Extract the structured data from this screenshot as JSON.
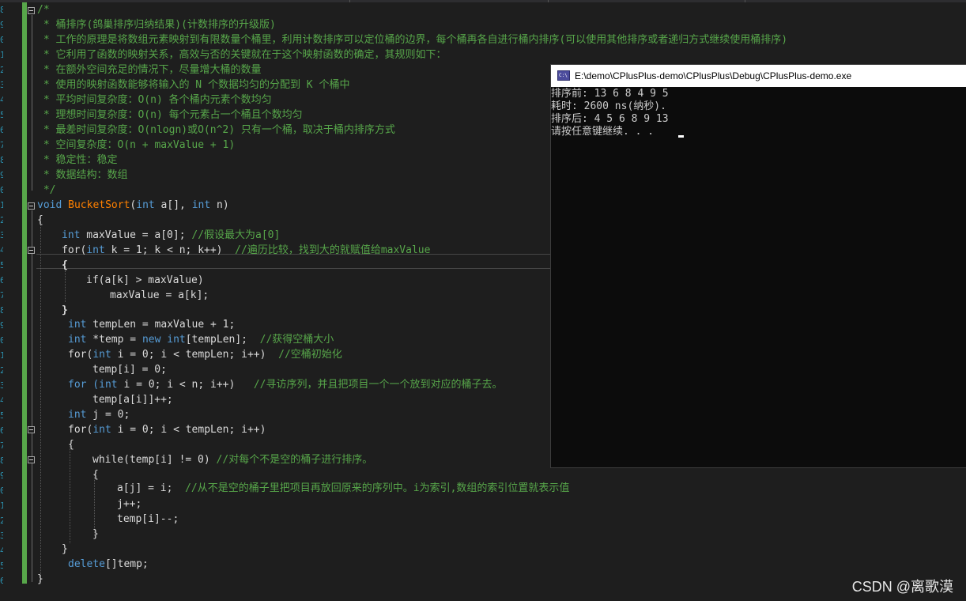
{
  "editor": {
    "line_number_digits": [
      "8",
      "9",
      "0",
      "1",
      "2",
      "3",
      "4",
      "5",
      "6",
      "7",
      "8",
      "9",
      "0",
      "1",
      "2",
      "3",
      "4",
      "5",
      "6",
      "7",
      "8",
      "9",
      "0",
      "1",
      "2",
      "3",
      "4",
      "5",
      "6",
      "7",
      "8",
      "9",
      "0",
      "1",
      "2",
      "3",
      "4",
      "5",
      "6"
    ],
    "code": {
      "l1": "/*",
      "l2": " * 桶排序(鸽巢排序归纳结果)(计数排序的升级版)",
      "l3": " * 工作的原理是将数组元素映射到有限数量个桶里，利用计数排序可以定位桶的边界，每个桶再各自进行桶内排序(可以使用其他排序或者递归方式继续使用桶排序)",
      "l4": " * 它利用了函数的映射关系，高效与否的关键就在于这个映射函数的确定，其规则如下：",
      "l5": " * 在额外空间充足的情况下，尽量增大桶的数量",
      "l6": " * 使用的映射函数能够将输入的 N 个数据均匀的分配到 K 个桶中",
      "l7": " * 平均时间复杂度：O(n) 各个桶内元素个数均匀",
      "l8": " * 理想时间复杂度：O(n) 每个元素占一个桶且个数均匀",
      "l9": " * 最差时间复杂度：O(nlogn)或O(n^2) 只有一个桶，取决于桶内排序方式",
      "l10": " * 空间复杂度：O(n + maxValue + 1)",
      "l11": " * 稳定性：稳定",
      "l12": " * 数据结构：数组",
      "l13": " */",
      "l14_kw": "void",
      "l14_fn": "BucketSort",
      "l14_a": "(",
      "l14_kw2": "int",
      "l14_b": " a[], ",
      "l14_kw3": "int",
      "l14_c": " n)",
      "l15": "{",
      "l17_kw": "int",
      "l17_a": " maxValue = a[0]; ",
      "l17_cmt": "//假设最大为a[0]",
      "l18_a": "for(",
      "l18_kw": "int",
      "l18_b": " k = 1; k < n; k++)  ",
      "l18_cmt": "//遍历比较，找到大的就赋值给maxValue",
      "l19": "{",
      "l20": "if(a[k] > maxValue)",
      "l21": "maxValue = a[k];",
      "l22": "}",
      "l23_kw": "int",
      "l23_a": " tempLen = maxValue + 1;",
      "l24_kw": "int",
      "l24_a": " *temp = ",
      "l24_kw2": "new",
      "l24_b": " ",
      "l24_kw3": "int",
      "l24_c": "[tempLen];  ",
      "l24_cmt": "//获得空桶大小",
      "l25_a": "for(",
      "l25_kw": "int",
      "l25_b": " i = 0; i < tempLen; i++)  ",
      "l25_cmt": "//空桶初始化",
      "l26": "temp[i] = 0;",
      "l27_a": "for (",
      "l27_kw": "int",
      "l27_b": " i = 0; i < n; i++)   ",
      "l27_cmt": "//寻访序列，并且把项目一个一个放到对应的桶子去。",
      "l28": "temp[a[i]]++;",
      "l29_kw": "int",
      "l29_a": " j = 0;",
      "l30_a": "for(",
      "l30_kw": "int",
      "l30_b": " i = 0; i < tempLen; i++)",
      "l31": "{",
      "l32_a": "while(temp[i] != 0) ",
      "l32_cmt": "//对每个不是空的桶子进行排序。",
      "l33": "{",
      "l34_a": "a[j] = i;  ",
      "l34_cmt": "//从不是空的桶子里把项目再放回原来的序列中。i为索引,数组的索引位置就表示值",
      "l35": "j++;",
      "l36": "temp[i]--;",
      "l37": "}",
      "l38": "}",
      "l39_kw": "delete",
      "l39_a": "[]temp;",
      "l40": "}"
    }
  },
  "console": {
    "title": "E:\\demo\\CPlusPlus-demo\\CPlusPlus\\Debug\\CPlusPlus-demo.exe",
    "icon": "console-app-icon",
    "lines": [
      "排序前: 13 6 8 4 9 5",
      "耗时: 2600 ns(纳秒).",
      "排序后: 4 5 6 8 9 13",
      "请按任意键继续. . . "
    ]
  },
  "watermark": "CSDN @离歌漠",
  "colors": {
    "background": "#1e1e1e",
    "comment": "#57a64a",
    "keyword": "#569cd6",
    "function": "#ff8000",
    "identifier": "#dadada",
    "console_bg": "#0c0c0c",
    "change_bar": "#57a64a"
  }
}
